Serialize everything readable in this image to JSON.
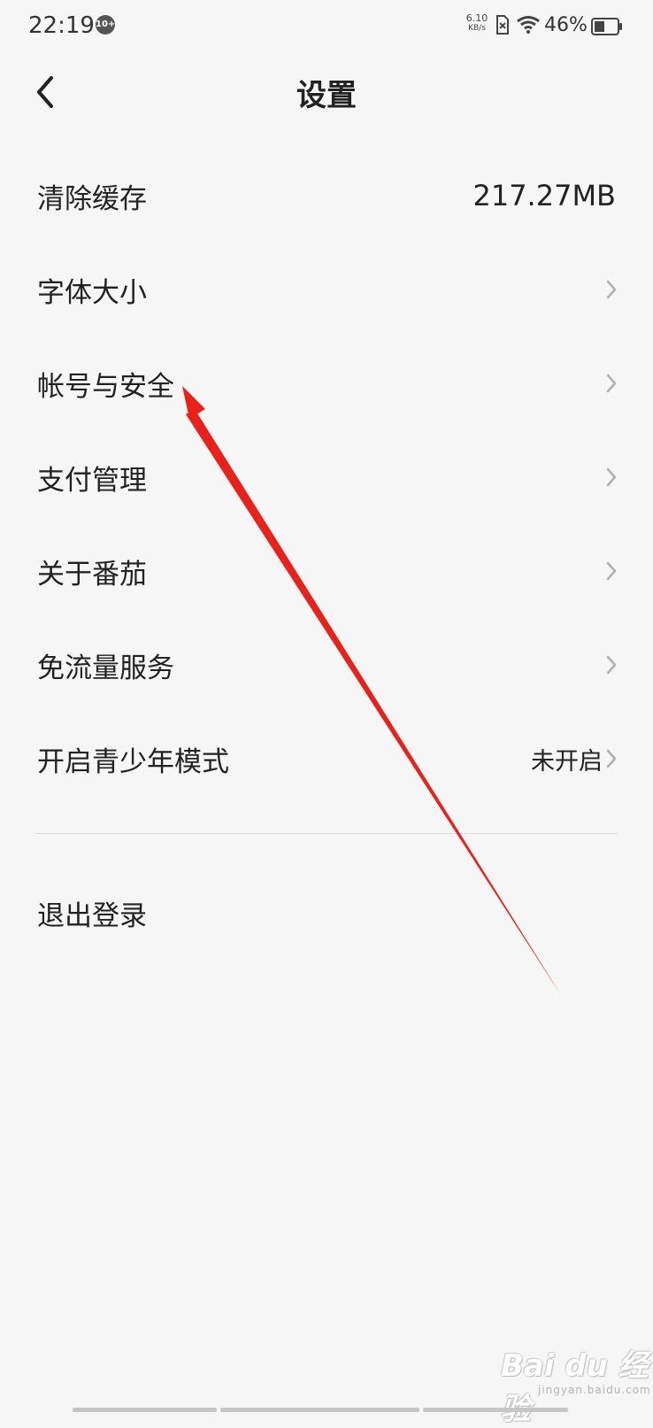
{
  "status_bar": {
    "time": "22:19",
    "notification_badge": "10+",
    "net_speed_value": "6.10",
    "net_speed_unit": "KB/s",
    "battery_percent": "46%",
    "battery_level": 0.46,
    "icons": [
      "notification-badge-icon",
      "sim-no-signal-icon",
      "wifi-icon",
      "battery-icon"
    ]
  },
  "header": {
    "title": "设置",
    "back_icon": "chevron-left-icon"
  },
  "settings": {
    "items": [
      {
        "label": "清除缓存",
        "value": "217.27MB",
        "chevron": false
      },
      {
        "label": "字体大小",
        "value": "",
        "chevron": true
      },
      {
        "label": "帐号与安全",
        "value": "",
        "chevron": true
      },
      {
        "label": "支付管理",
        "value": "",
        "chevron": true
      },
      {
        "label": "关于番茄",
        "value": "",
        "chevron": true
      },
      {
        "label": "免流量服务",
        "value": "",
        "chevron": true
      },
      {
        "label": "开启青少年模式",
        "value": "未开启",
        "chevron": true
      }
    ],
    "logout_label": "退出登录"
  },
  "watermark": {
    "brand": "Bai du 经验",
    "site": "jingyan.baidu.com"
  },
  "colors": {
    "background": "#f6f6f6",
    "text_primary": "#222222",
    "chevron": "#b0b0b0",
    "divider": "#dcdcdc",
    "annotation_arrow": "#e8221b"
  }
}
